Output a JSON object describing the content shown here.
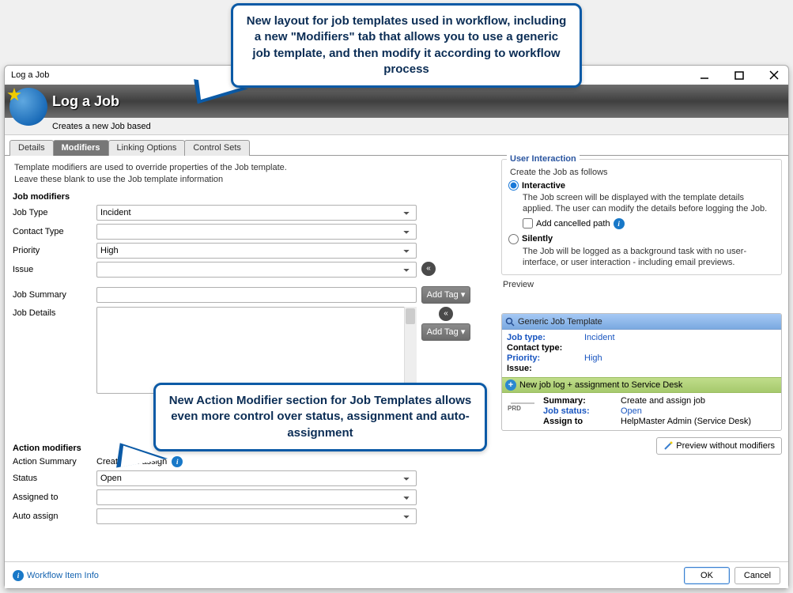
{
  "window": {
    "title": "Log a Job",
    "header_title": "Log a Job",
    "header_sub": "Creates a new Job based"
  },
  "tabs": {
    "details": "Details",
    "modifiers": "Modifiers",
    "linking": "Linking Options",
    "control_sets": "Control Sets"
  },
  "intro": {
    "line1": "Template modifiers are used to override properties of the Job template.",
    "line2": "Leave these blank to use the Job template information"
  },
  "job_modifiers": {
    "section": "Job modifiers",
    "job_type_label": "Job Type",
    "job_type_value": "Incident",
    "contact_type_label": "Contact Type",
    "contact_type_value": "",
    "priority_label": "Priority",
    "priority_value": "High",
    "issue_label": "Issue",
    "issue_value": "",
    "summary_label": "Job Summary",
    "summary_value": "",
    "details_label": "Job Details",
    "details_value": "",
    "add_tag": "Add Tag  ▾"
  },
  "action_modifiers": {
    "section": "Action modifiers",
    "action_summary_label": "Action Summary",
    "action_summary_value": "Create and assign",
    "status_label": "Status",
    "status_value": "Open",
    "assigned_to_label": "Assigned to",
    "assigned_to_value": "",
    "auto_assign_label": "Auto assign",
    "auto_assign_value": ""
  },
  "user_interaction": {
    "group_title": "User Interaction",
    "intro": "Create the Job as follows",
    "interactive_label": "Interactive",
    "interactive_desc": "The Job screen will be displayed with the template details applied. The user can modify the details before logging the Job.",
    "cancelled_label": "Add cancelled path",
    "silently_label": "Silently",
    "silently_desc": "The Job will be logged as a background task with no user-interface, or user interaction - including email previews."
  },
  "preview": {
    "label": "Preview",
    "template_name": "Generic Job Template",
    "rows": {
      "job_type_k": "Job type:",
      "job_type_v": "Incident",
      "contact_type_k": "Contact type:",
      "contact_type_v": "",
      "priority_k": "Priority:",
      "priority_v": "High",
      "issue_k": "Issue:",
      "issue_v": ""
    },
    "assign_bar": "New job log + assignment to Service Desk",
    "assign_rows": {
      "summary_k": "Summary:",
      "summary_v": "Create and assign job",
      "status_k": "Job status:",
      "status_v": "Open",
      "assign_k": "Assign to",
      "assign_v": "HelpMaster Admin (Service Desk)"
    },
    "preview_without": "Preview without modifiers"
  },
  "footer": {
    "info": "Workflow Item Info",
    "ok": "OK",
    "cancel": "Cancel"
  },
  "callouts": {
    "c1": "New layout for job templates used in workflow, including a new \"Modifiers\" tab that allows you to use a generic job template, and then modify it according to workflow process",
    "c2": "New Action Modifier section for Job Templates allows even more control over status, assignment and auto-assignment"
  }
}
